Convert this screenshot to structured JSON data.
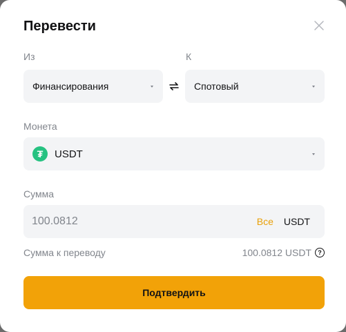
{
  "dialog": {
    "title": "Перевести",
    "from_label": "Из",
    "to_label": "К",
    "from_value": "Финансирования",
    "to_value": "Спотовый",
    "coin_label": "Монета",
    "coin_value": "USDT",
    "coin_icon_glyph": "₮",
    "amount_label": "Сумма",
    "amount_value": "100.0812",
    "all_button": "Все",
    "amount_currency": "USDT",
    "transfer_label": "Сумма к переводу",
    "transfer_value": "100.0812 USDT",
    "help_glyph": "?",
    "confirm_button": "Подтвердить"
  },
  "colors": {
    "accent": "#f2a208",
    "all_link": "#e9a008",
    "coin_icon": "#26c281"
  },
  "icons": {
    "close": "close-icon",
    "swap": "swap-icon",
    "dropdown": "chevron-down-icon",
    "help": "help-icon"
  }
}
